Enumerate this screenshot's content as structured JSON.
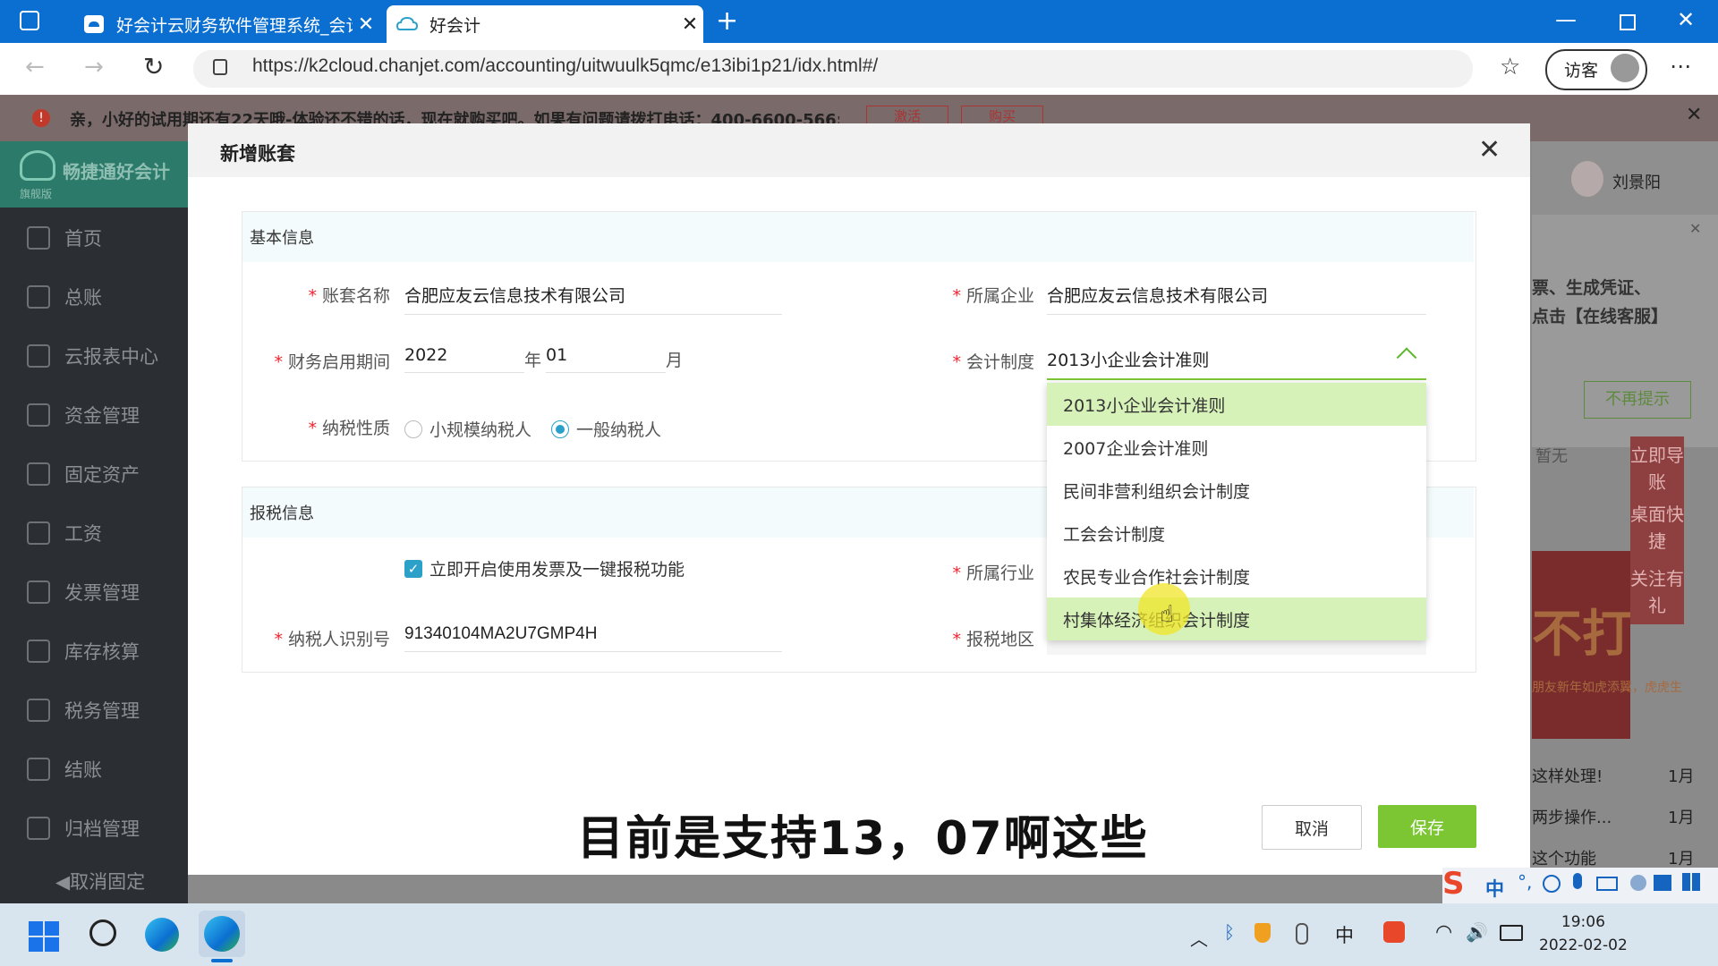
{
  "browser": {
    "tabs": [
      {
        "title": "好会计云财务软件管理系统_会计"
      },
      {
        "title": "好会计"
      }
    ],
    "url": "https://k2cloud.chanjet.com/accounting/uitwuulk5qmc/e13ibi1p21/idx.html#/",
    "guest_label": "访客"
  },
  "notice": {
    "text": "亲，小好的试用期还有22天哦-体验还不错的话，现在就购买吧。如果有问题请拨打电话：400-6600-566;",
    "btn_activate": "激活",
    "btn_buy": "购买"
  },
  "app": {
    "brand": "畅捷通好会计",
    "edition": "旗舰版",
    "user": "刘景阳",
    "sidebar": [
      "首页",
      "总账",
      "云报表中心",
      "资金管理",
      "固定资产",
      "工资",
      "发票管理",
      "库存核算",
      "税务管理",
      "结账",
      "归档管理"
    ],
    "unpin": "取消固定",
    "right_panel": {
      "hint_text": "票、生成凭证、点击【在线客服】",
      "dismiss": "不再提示",
      "none": "暂无",
      "float_links": [
        "立即导账",
        "桌面快捷",
        "关注有礼"
      ],
      "banner": "不打烊",
      "banner_sub": "朋友新年如虎添翼，虎虎生",
      "list": [
        {
          "text": "这样处理!",
          "date": "1月"
        },
        {
          "text": "两步操作...",
          "date": "1月"
        },
        {
          "text": "这个功能",
          "date": "1月"
        }
      ]
    }
  },
  "modal": {
    "title": "新增账套",
    "basic": {
      "heading": "基本信息",
      "name_label": "账套名称",
      "name_value": "合肥应友云信息技术有限公司",
      "company_label": "所属企业",
      "company_value": "合肥应友云信息技术有限公司",
      "period_label": "财务启用期间",
      "year": "2022",
      "year_unit": "年",
      "month": "01",
      "month_unit": "月",
      "system_label": "会计制度",
      "system_value": "2013小企业会计准则",
      "tax_label": "纳税性质",
      "tax_small": "小规模纳税人",
      "tax_general": "一般纳税人"
    },
    "tax": {
      "heading": "报税信息",
      "enable_invoice": "立即开启使用发票及一键报税功能",
      "industry_label": "所属行业",
      "taxid_label": "纳税人识别号",
      "taxid_value": "91340104MA2U7GMP4H",
      "region_label": "报税地区"
    },
    "dropdown_options": [
      "2013小企业会计准则",
      "2007企业会计准则",
      "民间非营利组织会计制度",
      "工会会计制度",
      "农民专业合作社会计制度",
      "村集体经济组织会计制度"
    ],
    "cancel": "取消",
    "save": "保存"
  },
  "subtitle": "目前是支持13，07啊这些",
  "taskbar": {
    "ime": "中",
    "time": "19:06",
    "date": "2022-02-02"
  },
  "colors": {
    "accent": "#7cc634",
    "highlight": "#d6f2b8",
    "browser_blue": "#0b6fd1"
  }
}
